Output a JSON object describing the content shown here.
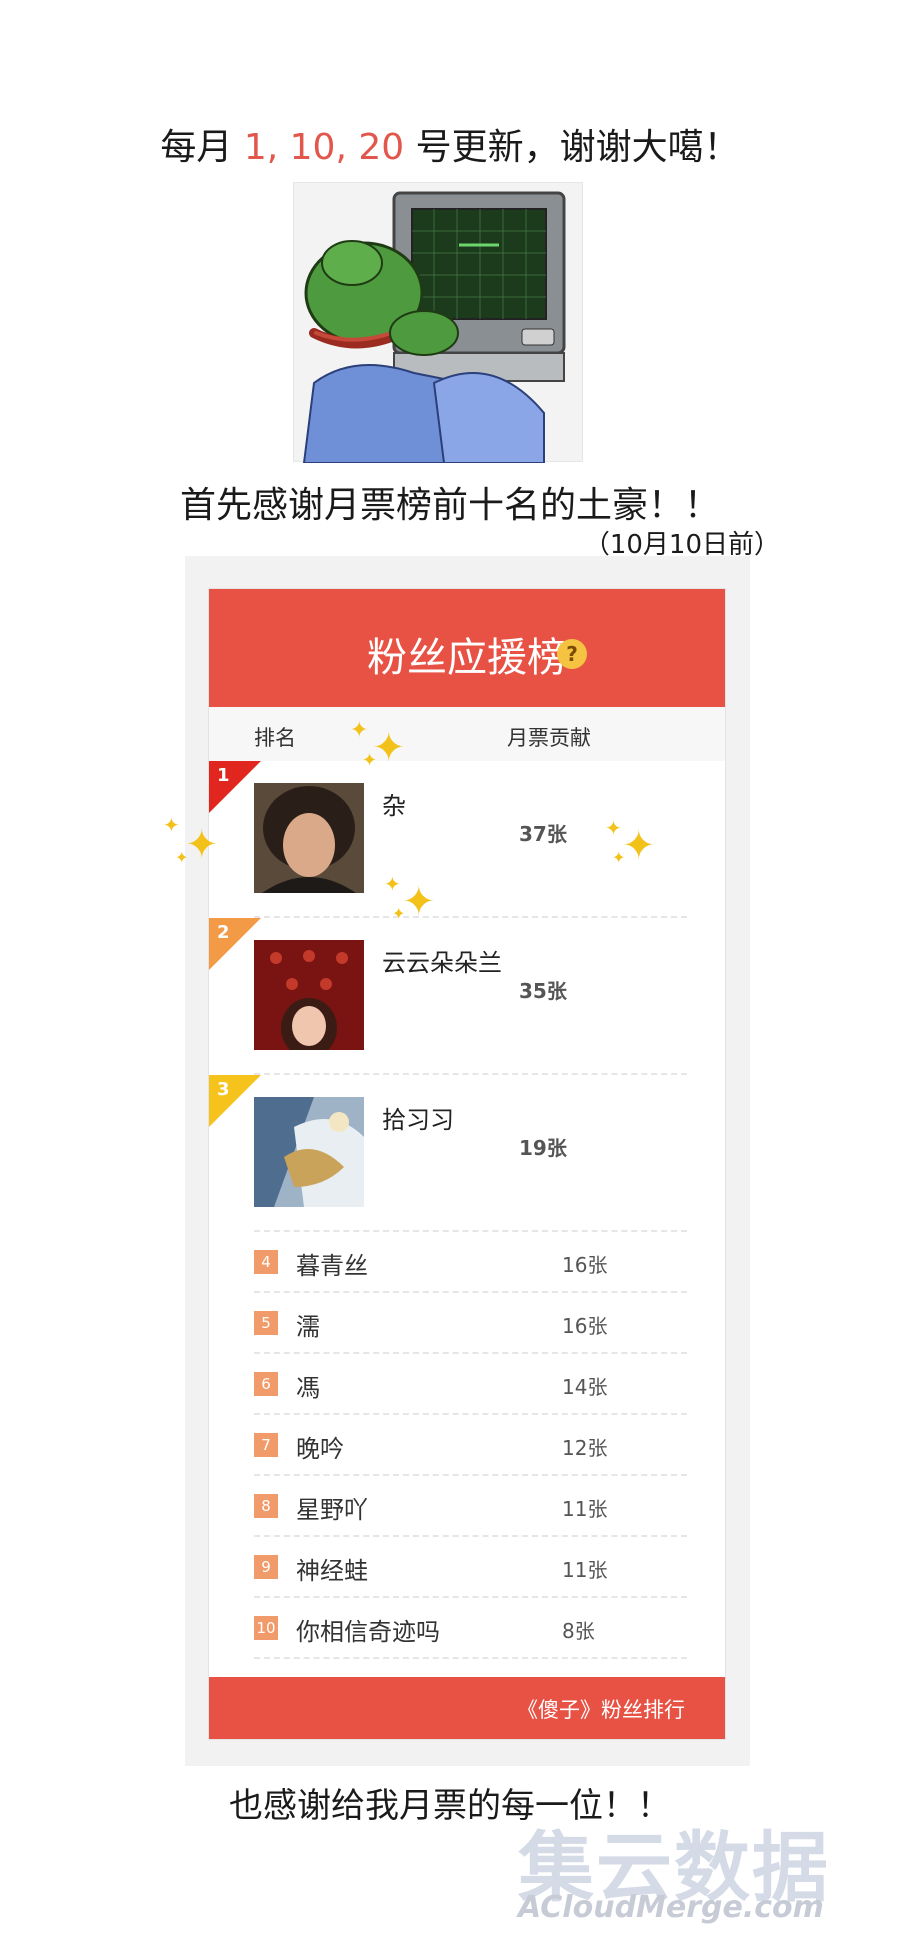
{
  "update": {
    "prefix": "每月 ",
    "dates": "1, 10, 20",
    "suffix": " 号更新，谢谢大噶！"
  },
  "thanks_top": "首先感谢月票榜前十名的土豪！！",
  "date_note": "（10月10日前）",
  "board": {
    "title": "粉丝应援榜",
    "help_icon": "?",
    "headers": {
      "rank": "排名",
      "votes": "月票贡献"
    },
    "top3": [
      {
        "rank": "1",
        "name": "杂",
        "votes": "37张",
        "flag_color": "#e0261e"
      },
      {
        "rank": "2",
        "name": "云云朵朵兰",
        "votes": "35张",
        "flag_color": "#f39a47"
      },
      {
        "rank": "3",
        "name": "拾习习",
        "votes": "19张",
        "flag_color": "#f6c21c"
      }
    ],
    "rows": [
      {
        "rank": "4",
        "name": "暮青丝",
        "votes": "16张"
      },
      {
        "rank": "5",
        "name": "濡",
        "votes": "16张"
      },
      {
        "rank": "6",
        "name": "馮",
        "votes": "14张"
      },
      {
        "rank": "7",
        "name": "晚吟",
        "votes": "12张"
      },
      {
        "rank": "8",
        "name": "星野吖",
        "votes": "11张"
      },
      {
        "rank": "9",
        "name": "神经蛙",
        "votes": "11张"
      },
      {
        "rank": "10",
        "name": "你相信奇迹吗",
        "votes": "8张"
      }
    ],
    "footer": "《傻子》粉丝排行"
  },
  "thanks_bottom": "也感谢给我月票的每一位！！",
  "watermark": {
    "cn": "集云数据",
    "en": "ACloudMerge.com"
  },
  "colors": {
    "accent": "#e85245",
    "highlight": "#e2574c",
    "sparkle": "#f2c21a"
  }
}
